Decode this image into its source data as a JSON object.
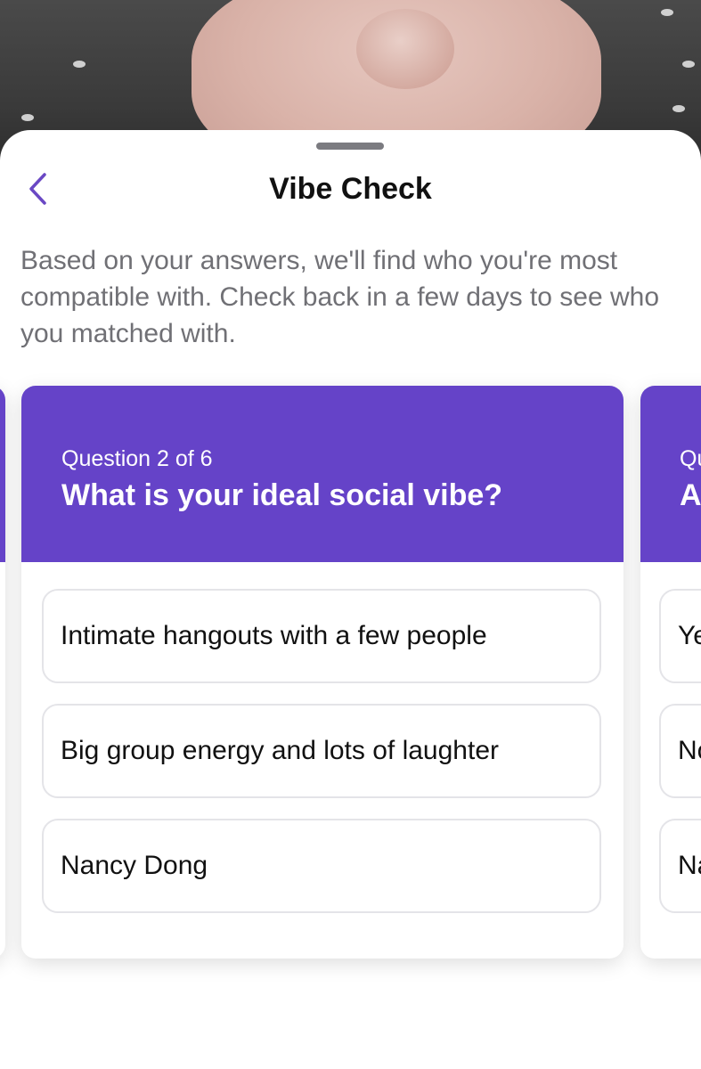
{
  "header": {
    "title": "Vibe Check"
  },
  "description": "Based on your answers, we'll find who you're most compatible with. Check back in a few days to see who you matched with.",
  "current_card": {
    "question_count": "Question 2 of 6",
    "question": "What is your ideal social vibe?",
    "options": [
      "Intimate hangouts with a few people",
      "Big group energy and lots of laughter",
      "Nancy Dong"
    ]
  },
  "next_card": {
    "question_count_partial": "Qu",
    "question_partial": "A",
    "options_partial": [
      "Ye",
      "No",
      "Na"
    ]
  },
  "colors": {
    "accent": "#6543c8",
    "back_chevron": "#6a48c4",
    "description_text": "#707075"
  },
  "icons": {
    "back": "chevron-left-icon"
  }
}
